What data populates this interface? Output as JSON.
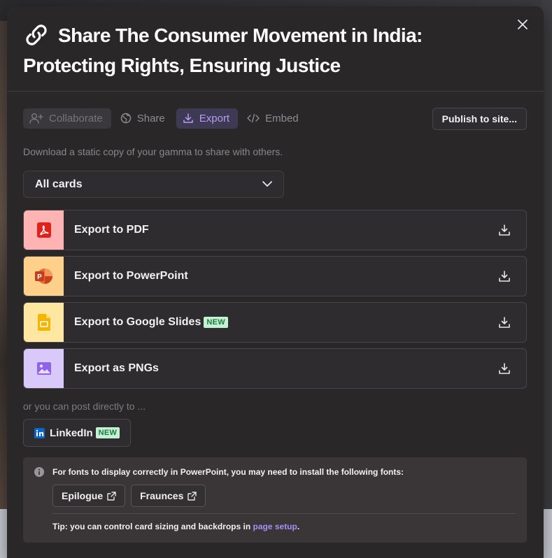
{
  "modal": {
    "title_line1": "Share The Consumer Movement in India:",
    "title_line2": "Protecting Rights, Ensuring Justice"
  },
  "tabs": [
    {
      "label": "Collaborate",
      "icon": "add-user-icon",
      "state": "disabled"
    },
    {
      "label": "Share",
      "icon": "globe-icon",
      "state": "default"
    },
    {
      "label": "Export",
      "icon": "download-icon",
      "state": "active"
    },
    {
      "label": "Embed",
      "icon": "code-icon",
      "state": "default"
    }
  ],
  "publish_label": "Publish to site...",
  "description": "Download a static copy of your gamma to share with others.",
  "scope_select": {
    "value": "All cards"
  },
  "exports": [
    {
      "label": "Export to PDF",
      "icon": "pdf-icon",
      "icon_bg": "#ffb3b3",
      "badge": ""
    },
    {
      "label": "Export to PowerPoint",
      "icon": "powerpoint-icon",
      "icon_bg": "#ffd08a",
      "badge": ""
    },
    {
      "label": "Export to Google Slides",
      "icon": "google-slides-icon",
      "icon_bg": "#ffe7a1",
      "badge": "NEW"
    },
    {
      "label": "Export as PNGs",
      "icon": "image-icon",
      "icon_bg": "#d9c8fa",
      "badge": ""
    }
  ],
  "post_text": "or you can post directly to ...",
  "linkedin": {
    "label": "LinkedIn",
    "badge": "NEW"
  },
  "info": {
    "message": "For fonts to display correctly in PowerPoint, you may need to install the following fonts:",
    "fonts": [
      "Epilogue",
      "Fraunces"
    ],
    "tip_prefix": "Tip: you can control card sizing and backdrops in ",
    "tip_link": "page setup",
    "tip_suffix": "."
  },
  "colors": {
    "accent": "#b79cf6",
    "badge_bg": "#c5f1d3",
    "badge_text": "#1b7a43",
    "modal_bg": "#2a2729"
  }
}
